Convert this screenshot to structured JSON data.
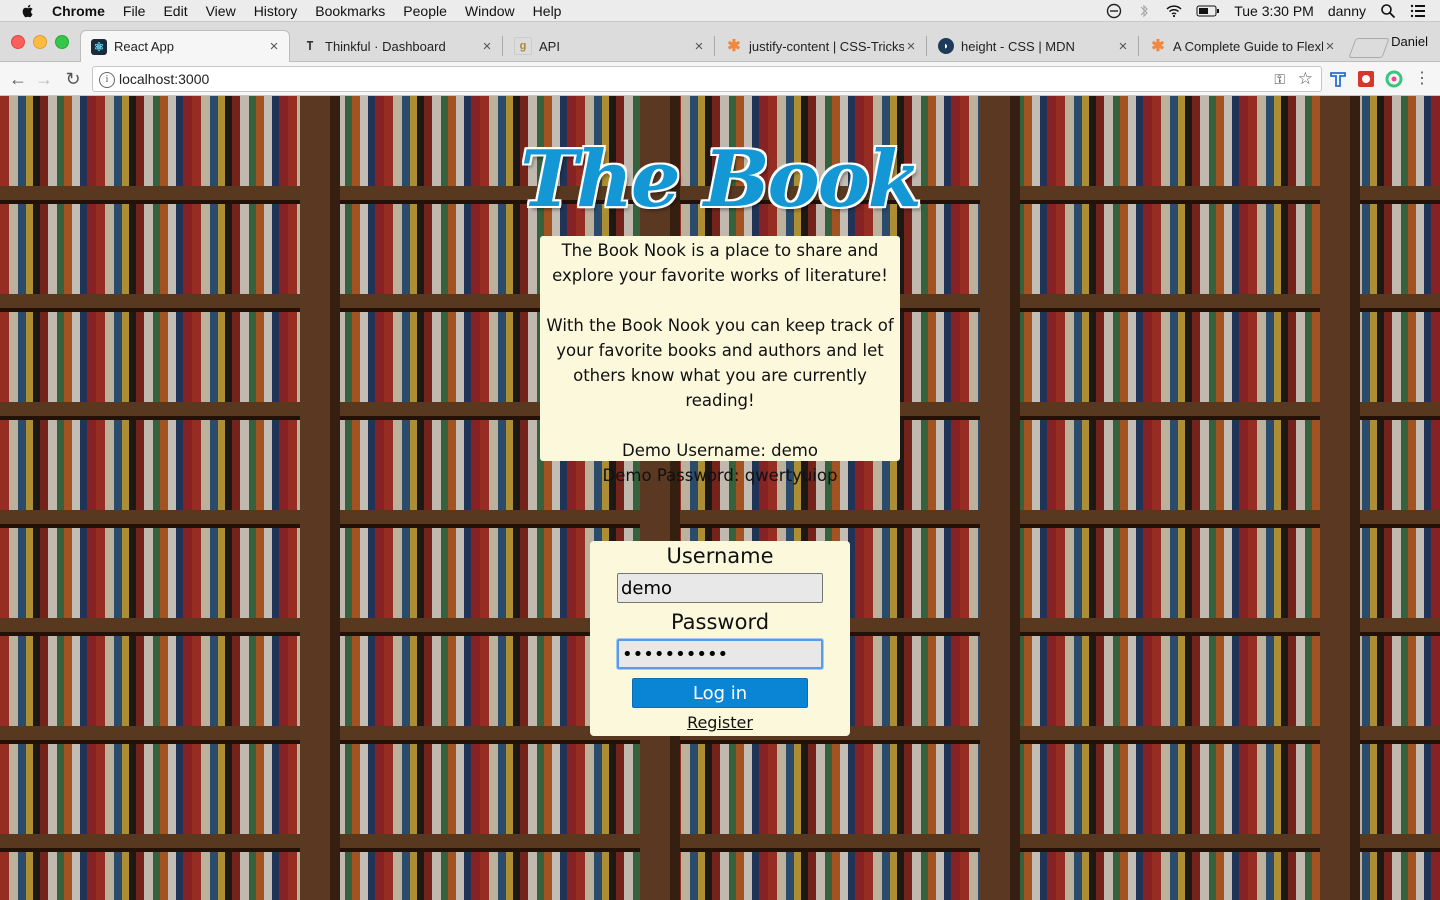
{
  "menubar": {
    "app_name": "Chrome",
    "items": [
      "File",
      "Edit",
      "View",
      "History",
      "Bookmarks",
      "People",
      "Window",
      "Help"
    ],
    "clock": "Tue 3:30 PM",
    "user": "danny"
  },
  "tabs": [
    {
      "title": "React App",
      "favicon": "react-icon",
      "active": true
    },
    {
      "title": "Thinkful · Dashboard",
      "favicon": "thinkful-icon"
    },
    {
      "title": "API",
      "favicon": "g-icon"
    },
    {
      "title": "justify-content | CSS-Tricks",
      "favicon": "css-tricks-icon"
    },
    {
      "title": "height - CSS | MDN",
      "favicon": "mdn-icon"
    },
    {
      "title": "A Complete Guide to Flexbo",
      "favicon": "css-tricks-icon"
    }
  ],
  "profile_name": "Daniel",
  "address": {
    "url": "localhost:3000"
  },
  "brand": {
    "title": "The Book Nook",
    "color": "#1498d5"
  },
  "about": {
    "line1": "The Book Nook is a place to share and",
    "line2": "explore your favorite works of literature!",
    "line3": "With the Book Nook you can keep track of",
    "line4": "your favorite books and authors and let",
    "line5": "others know what you are currently reading!",
    "demo_user": "Demo Username: demo",
    "demo_pass": "Demo Password: qwertyuiop"
  },
  "login": {
    "username_label": "Username",
    "username_value": "demo",
    "password_label": "Password",
    "password_value": "qwertyuiop",
    "submit_label": "Log in",
    "register_label": "Register",
    "accent": "#0a84d4"
  }
}
